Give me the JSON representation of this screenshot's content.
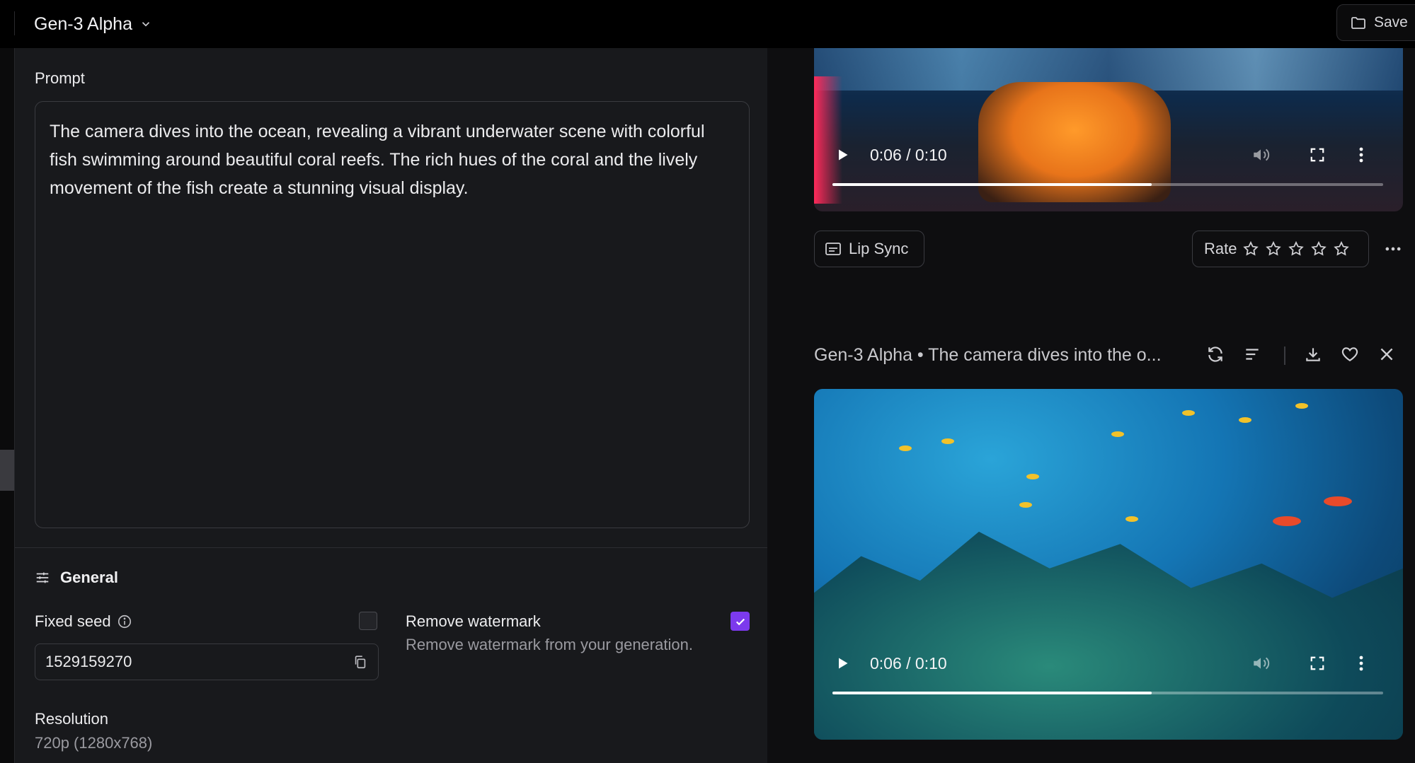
{
  "header": {
    "model_label": "Gen-3 Alpha",
    "save_label": "Save"
  },
  "prompt": {
    "label": "Prompt",
    "text": "The camera dives into the ocean, revealing a vibrant underwater scene with colorful fish swimming around beautiful coral reefs. The rich hues of the coral and the lively movement of the fish create a stunning visual display."
  },
  "general": {
    "title": "General",
    "fixed_seed_label": "Fixed seed",
    "fixed_seed_checked": false,
    "seed_value": "1529159270",
    "watermark_label": "Remove watermark",
    "watermark_desc": "Remove watermark from your generation.",
    "watermark_checked": true,
    "resolution_label": "Resolution",
    "resolution_value": "720p (1280x768)"
  },
  "videos": [
    {
      "time": "0:06 / 0:10",
      "progress": 0.58
    },
    {
      "title": "Gen-3 Alpha • The camera dives into the o...",
      "time": "0:06 / 0:10",
      "progress": 0.58
    }
  ],
  "actions": {
    "lip_sync_label": "Lip Sync",
    "rate_label": "Rate"
  },
  "colors": {
    "accent": "#7c3aed",
    "panel": "#18191c",
    "border": "#3a3b40"
  }
}
